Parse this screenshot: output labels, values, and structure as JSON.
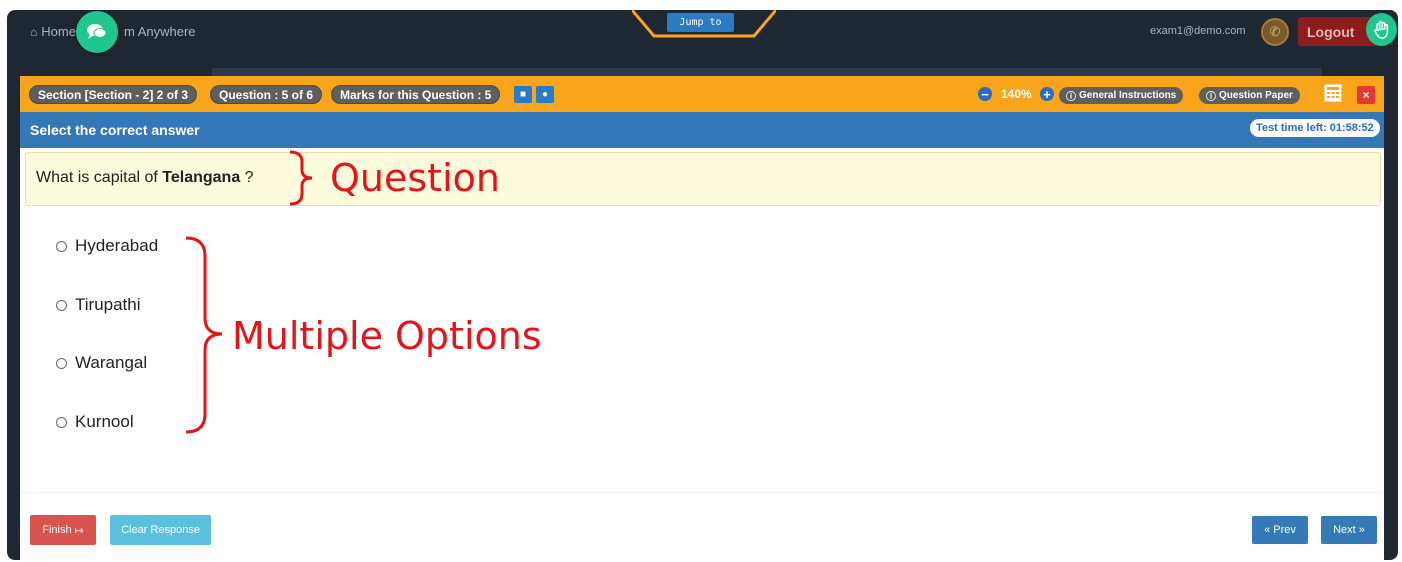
{
  "navbar": {
    "home_label": "Home",
    "brand_suffix": "m Anywhere",
    "jump_label": "Jump to",
    "user_email": "exam1@demo.com",
    "logout_label": "Logout"
  },
  "infobar": {
    "section_label": "Section [Section - 2] 2 of 3",
    "question_counter": "Question : 5 of 6",
    "marks_label": "Marks for this Question : 5",
    "zoom_level": "140%",
    "general_instructions_label": "General Instructions",
    "question_paper_label": "Question Paper",
    "close_symbol": "×"
  },
  "titlebar": {
    "instruction": "Select the correct answer",
    "timer": "Test time left: 01:58:52"
  },
  "question": {
    "prefix": "What is capital of ",
    "highlight": "Telangana",
    "suffix": " ?"
  },
  "options": [
    {
      "label": "Hyderabad",
      "selected": false
    },
    {
      "label": "Tirupathi",
      "selected": false
    },
    {
      "label": "Warangal",
      "selected": false
    },
    {
      "label": "Kurnool",
      "selected": false
    }
  ],
  "footer": {
    "finish_label": "Finish",
    "clear_label": "Clear Response",
    "prev_label": "« Prev",
    "next_label": "Next »"
  },
  "annotations": {
    "question": "Question",
    "options": "Multiple Options",
    "color": "#e0161b"
  },
  "colors": {
    "frame": "#1f2733",
    "accent_orange": "#f8a51b",
    "title_blue": "#3578b8",
    "fab_green": "#1fc78c",
    "danger_red": "#d9534f",
    "info_cyan": "#5bc0de",
    "primary_blue": "#337ab7"
  }
}
